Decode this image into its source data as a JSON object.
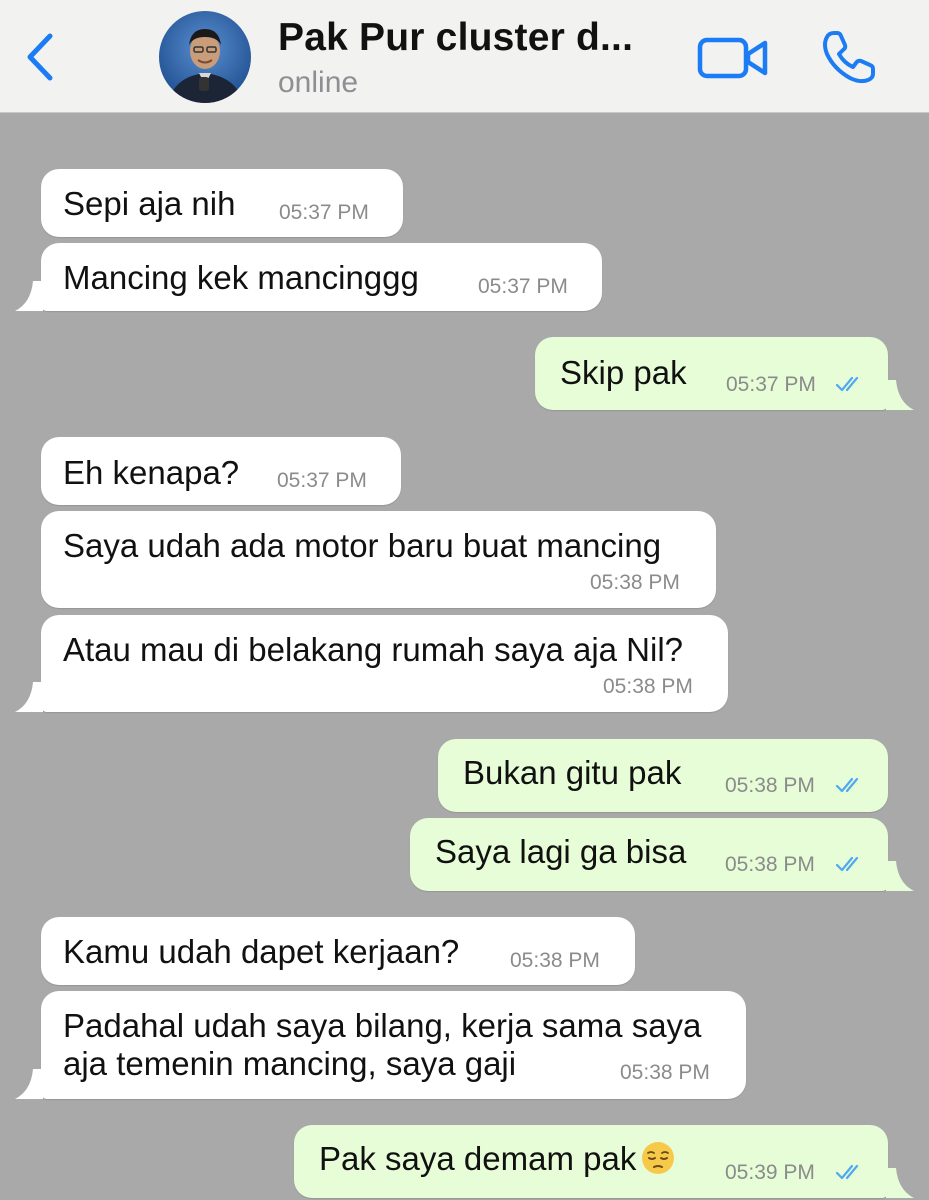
{
  "header": {
    "contact_name": "Pak Pur cluster d...",
    "status": "online"
  },
  "icons": {
    "back": "chevron-left-icon",
    "video": "video-camera-icon",
    "call": "phone-icon",
    "read": "double-check-icon",
    "emoji": "pensive-face-emoji"
  },
  "colors": {
    "accent": "#1b7cf4",
    "background": "#a9a9a9",
    "incoming_bubble": "#ffffff",
    "outgoing_bubble": "#e6fdd7",
    "read_ticks": "#4fa8f0"
  },
  "messages": [
    {
      "direction": "in",
      "text": "Sepi aja nih",
      "time": "05:37 PM"
    },
    {
      "direction": "in",
      "text": "Mancing kek mancinggg",
      "time": "05:37 PM"
    },
    {
      "direction": "out",
      "text": "Skip pak",
      "time": "05:37 PM",
      "read": true
    },
    {
      "direction": "in",
      "text": "Eh kenapa?",
      "time": "05:37 PM"
    },
    {
      "direction": "in",
      "text": "Saya udah ada motor baru buat mancing",
      "time": "05:38 PM"
    },
    {
      "direction": "in",
      "text": "Atau mau di belakang rumah saya aja Nil?",
      "time": "05:38 PM"
    },
    {
      "direction": "out",
      "text": "Bukan gitu pak",
      "time": "05:38 PM",
      "read": true
    },
    {
      "direction": "out",
      "text": "Saya lagi ga bisa",
      "time": "05:38 PM",
      "read": true
    },
    {
      "direction": "in",
      "text": "Kamu udah dapet kerjaan?",
      "time": "05:38 PM"
    },
    {
      "direction": "in",
      "line1": "Padahal udah saya bilang, kerja sama saya",
      "line2": "aja temenin mancing, saya gaji",
      "time": "05:38 PM"
    },
    {
      "direction": "out",
      "text": "Pak saya demam pak",
      "emoji": "😔",
      "time": "05:39 PM",
      "read": true
    }
  ]
}
